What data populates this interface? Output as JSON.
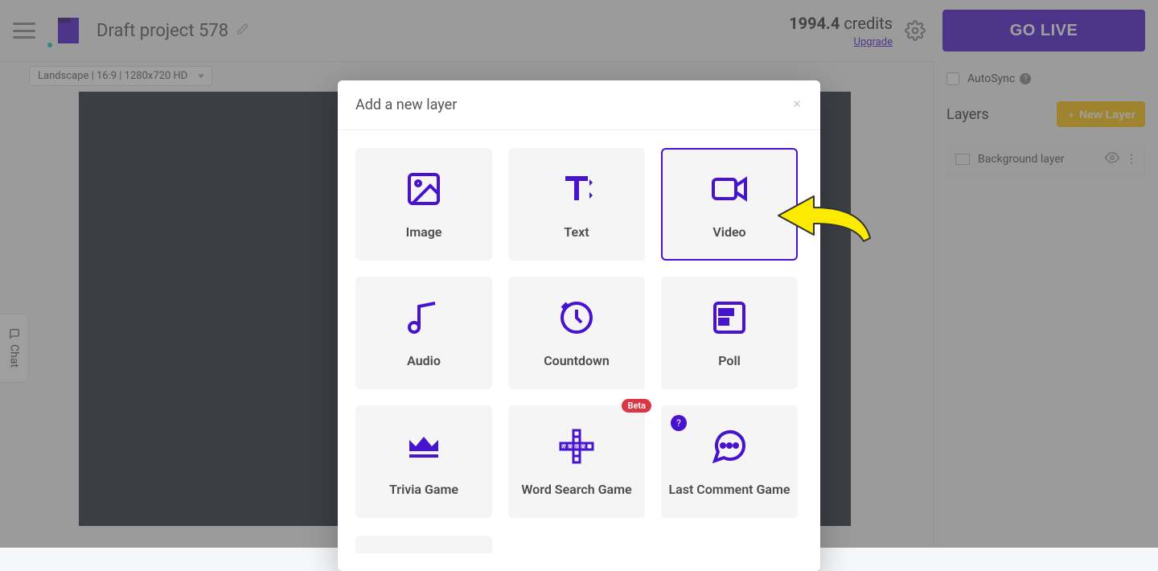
{
  "header": {
    "project_title": "Draft project 578",
    "credits_value": "1994.4",
    "credits_label": "credits",
    "upgrade_label": "Upgrade",
    "go_live_label": "GO LIVE"
  },
  "toolbar": {
    "orientation_label": "Landscape | 16:9 | 1280x720 HD"
  },
  "panel": {
    "autosync_label": "AutoSync",
    "layers_title": "Layers",
    "new_layer_button": "New Layer",
    "layer_items": [
      {
        "name": "Background layer"
      }
    ]
  },
  "chat_tab": {
    "label": "Chat"
  },
  "modal": {
    "title": "Add a new layer",
    "options": [
      {
        "label": "Image",
        "icon": "image-icon"
      },
      {
        "label": "Text",
        "icon": "text-icon"
      },
      {
        "label": "Video",
        "icon": "video-icon",
        "selected": true
      },
      {
        "label": "Audio",
        "icon": "audio-icon"
      },
      {
        "label": "Countdown",
        "icon": "countdown-icon"
      },
      {
        "label": "Poll",
        "icon": "poll-icon"
      },
      {
        "label": "Trivia Game",
        "icon": "crown-icon"
      },
      {
        "label": "Word Search Game",
        "icon": "word-search-icon",
        "badge": "Beta"
      },
      {
        "label": "Last Comment Game",
        "icon": "comment-icon",
        "help": true
      }
    ],
    "beta_badge_text": "Beta",
    "help_badge_text": "?"
  },
  "colors": {
    "accent": "#4713cf",
    "warning": "#ffc107",
    "beta": "#dc3545",
    "canvas": "#222938"
  }
}
